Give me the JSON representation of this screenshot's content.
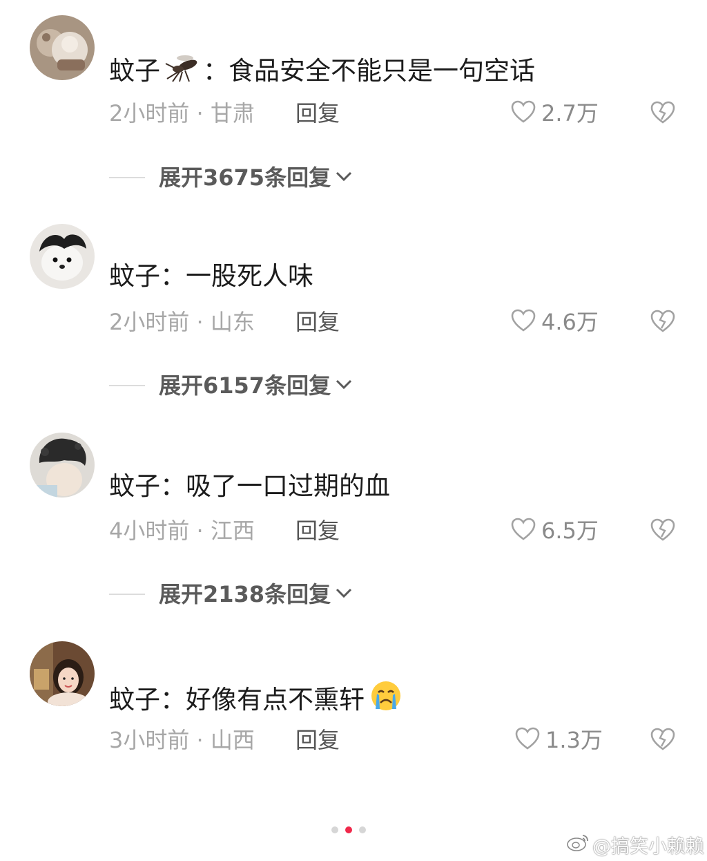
{
  "comments": [
    {
      "text": "蚊子🦟：食品安全不能只是一句空话",
      "prefix": "蚊子",
      "body": "：食品安全不能只是一句空话",
      "emoji": "mosquito-emoji",
      "meta": "2小时前 · 甘肃",
      "reply": "回复",
      "likes": "2.7万",
      "expand": "展开3675条回复"
    },
    {
      "text": "蚊子：一股死人味",
      "prefix": "蚊子",
      "body": "：一股死人味",
      "meta": "2小时前 · 山东",
      "reply": "回复",
      "likes": "4.6万",
      "expand": "展开6157条回复"
    },
    {
      "text": "蚊子：吸了一口过期的血",
      "prefix": "蚊子",
      "body": "：吸了一口过期的血",
      "meta": "4小时前 · 江西",
      "reply": "回复",
      "likes": "6.5万",
      "expand": "展开2138条回复"
    },
    {
      "text": "蚊子：好像有点不熏轩😭",
      "prefix": "蚊子",
      "body": "：好像有点不熏轩",
      "emoji": "crying-face-emoji",
      "meta": "3小时前 · 山西",
      "reply": "回复",
      "likes": "1.3万"
    }
  ],
  "pager": {
    "count": 3,
    "active": 2
  },
  "watermark": "@搞笑小赖赖",
  "colors": {
    "accent": "#f0284a",
    "meta": "#a7a7a7",
    "text": "#1c1c1c"
  }
}
